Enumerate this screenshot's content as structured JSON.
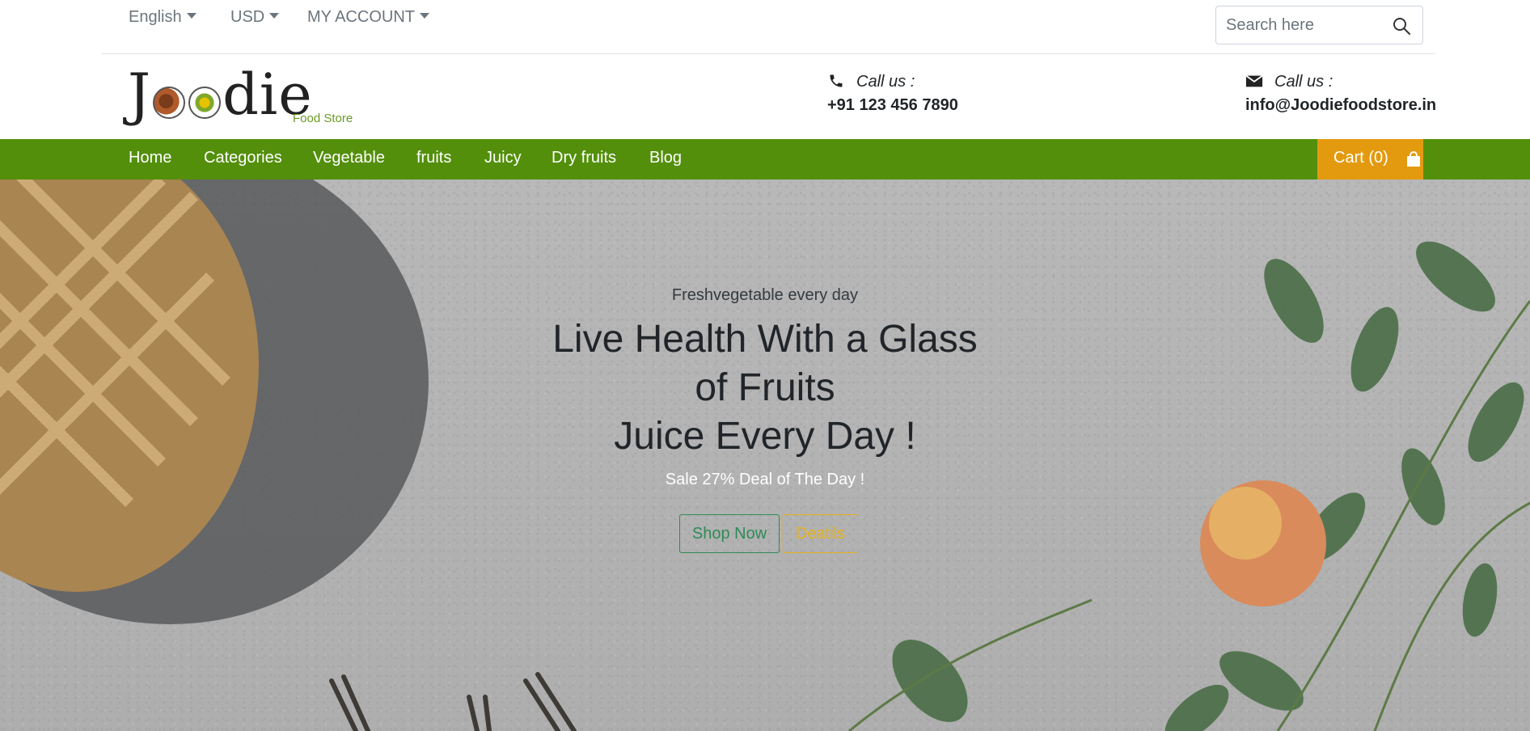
{
  "topbar": {
    "language": "English",
    "currency": "USD",
    "account": "MY ACCOUNT",
    "search_placeholder": "Search here"
  },
  "header": {
    "logo_text": "Joodie",
    "logo_tagline": "Food Store",
    "phone": {
      "label": "Call us :",
      "value": "+91 123 456 7890",
      "icon": "phone-icon"
    },
    "email": {
      "label": "Call us :",
      "value": "info@Joodiefoodstore.in",
      "icon": "envelope-icon"
    }
  },
  "nav": {
    "items": [
      {
        "label": "Home"
      },
      {
        "label": "Categories"
      },
      {
        "label": "Vegetable"
      },
      {
        "label": "fruits"
      },
      {
        "label": "Juicy"
      },
      {
        "label": "Dry fruits"
      },
      {
        "label": "Blog"
      }
    ],
    "cart_label": "Cart (0)",
    "cart_icon": "shopping-bag-icon"
  },
  "hero": {
    "kicker": "Freshvegetable every day",
    "headline_line1": "Live Health With a Glass",
    "headline_line2": "of Fruits",
    "headline_line3": "Juice Every Day !",
    "subtitle": "Sale 27% Deal of The Day !",
    "shop_button": "Shop Now",
    "details_button": "Deatils"
  },
  "colors": {
    "nav_green": "#538f0b",
    "cart_orange": "#e39a0e",
    "shop_green": "#2e8b57",
    "details_yellow": "#e6b21a"
  }
}
